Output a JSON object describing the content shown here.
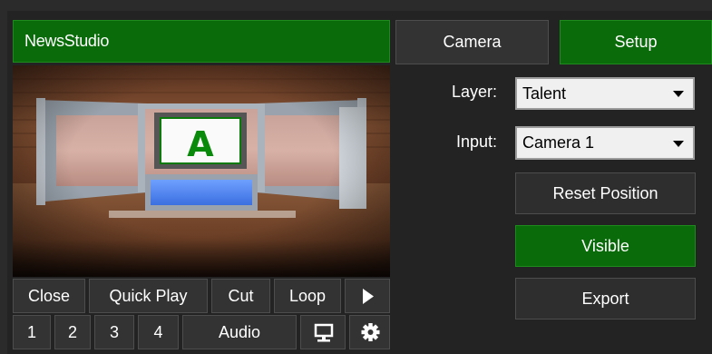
{
  "app": {
    "title": "NewsStudio"
  },
  "preview": {
    "monitor_letter": "A"
  },
  "tabs": [
    {
      "label": "Camera"
    },
    {
      "label": "Setup"
    }
  ],
  "layer": {
    "label": "Layer:",
    "value": "Talent"
  },
  "input": {
    "label": "Input:",
    "value": "Camera 1"
  },
  "actions": {
    "reset_position": "Reset Position",
    "visible": "Visible",
    "export": "Export"
  },
  "controls": {
    "close": "Close",
    "quick_play": "Quick Play",
    "cut": "Cut",
    "loop": "Loop",
    "num1": "1",
    "num2": "2",
    "num3": "3",
    "num4": "4",
    "audio": "Audio"
  },
  "icons": {
    "play": "play-icon",
    "monitor": "monitor-icon",
    "settings": "gear-icon"
  },
  "colors": {
    "accent_green": "#0a6b0a",
    "background": "#232323",
    "button": "#333333"
  }
}
